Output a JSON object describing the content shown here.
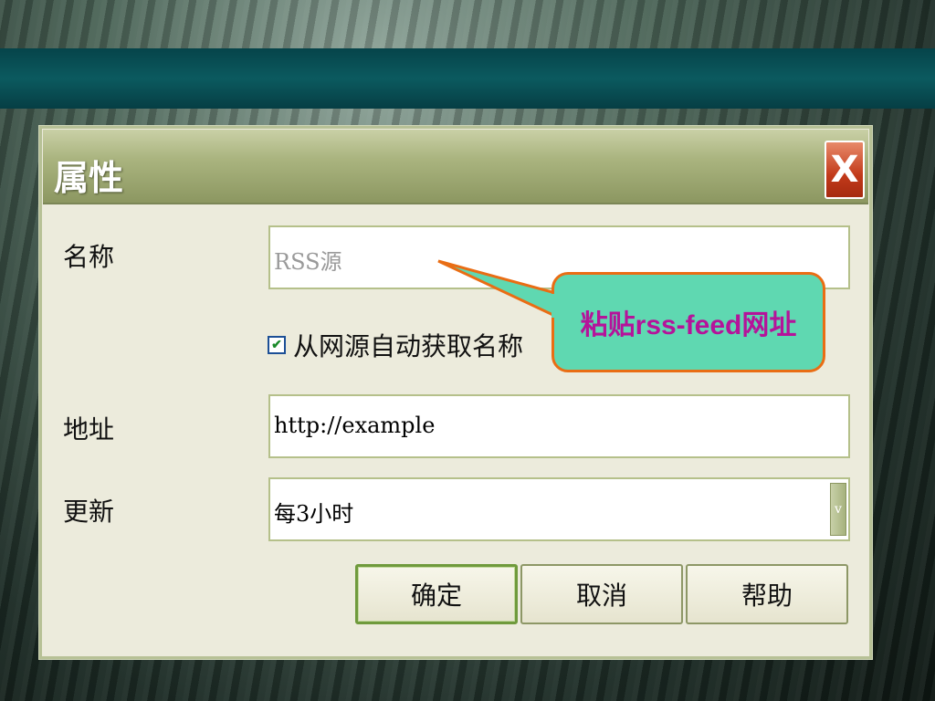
{
  "dialog": {
    "title": "属性",
    "close_label": "X"
  },
  "fields": {
    "name_label": "名称",
    "name_placeholder": "RSS源",
    "auto_name_checkbox": {
      "label": "从网源自动获取名称",
      "checked": true
    },
    "address_label": "地址",
    "address_value": "http://example",
    "update_label": "更新",
    "update_value": "每3小时"
  },
  "buttons": {
    "ok": "确定",
    "cancel": "取消",
    "help": "帮助"
  },
  "callout": {
    "text": "粘贴rss-feed网址"
  },
  "colors": {
    "callout_fill": "#5fd8b1",
    "callout_border": "#e96d14",
    "callout_text": "#b5139a",
    "titlebar": "#aab47f",
    "close_button": "#c23a1a"
  },
  "icons": {
    "close": "close-icon",
    "checkbox": "check-icon",
    "dropdown": "chevron-down-icon"
  }
}
